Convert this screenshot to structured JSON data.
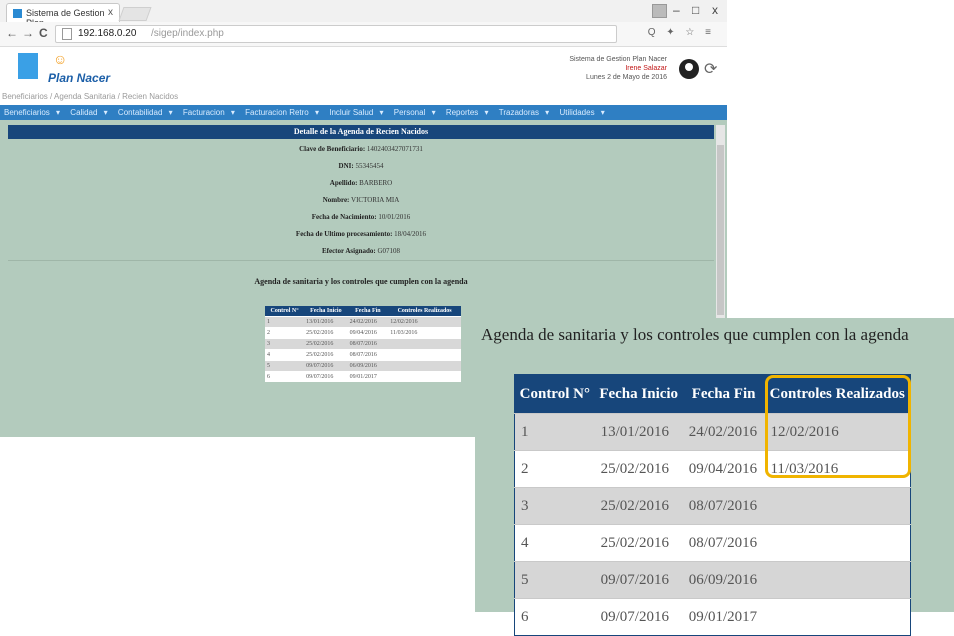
{
  "browser": {
    "tab_title": "Sistema de Gestion Plan",
    "tab_close": "x",
    "window_controls": {
      "minimize": "–",
      "maximize": "□",
      "close": "x"
    },
    "nav": {
      "back": "←",
      "forward": "→",
      "reload": "C"
    },
    "url_host": "192.168.0.20",
    "url_path": "/sigep/index.php",
    "addr_icons": "Q ✦ ☆ ≡"
  },
  "header": {
    "logo_label": "Plan Nacer",
    "system_name": "Sistema de Gestion Plan Nacer",
    "user_name": "Irene Salazar",
    "date": "Lunes 2 de Mayo de 2016",
    "logout_icon": "logout-icon"
  },
  "breadcrumb": "Beneficiarios / Agenda Sanitaria / Recien Nacidos",
  "menu": {
    "items": [
      "Beneficiarios",
      "Calidad",
      "Contabilidad",
      "Facturacion",
      "Facturacion Retro",
      "Incluir Salud",
      "Personal",
      "Reportes",
      "Trazadoras",
      "Utilidades"
    ]
  },
  "detail": {
    "title": "Detalle de la Agenda de Recien Nacidos",
    "fields": [
      {
        "label": "Clave de Beneficiario:",
        "value": "1402403427071731"
      },
      {
        "label": "DNI:",
        "value": "55345454"
      },
      {
        "label": "Apellido:",
        "value": "BARBERO"
      },
      {
        "label": "Nombre:",
        "value": "VICTORIA MIA"
      },
      {
        "label": "Fecha de Nacimiento:",
        "value": "10/01/2016"
      },
      {
        "label": "Fecha de Ultimo procesamiento:",
        "value": "18/04/2016"
      },
      {
        "label": "Efector Asignado:",
        "value": "G07108"
      }
    ]
  },
  "agenda": {
    "title": "Agenda de sanitaria y los controles que cumplen con la agenda",
    "headers": [
      "Control N°",
      "Fecha Inicio",
      "Fecha Fin",
      "Controles Realizados"
    ],
    "rows": [
      [
        "1",
        "13/01/2016",
        "24/02/2016",
        "12/02/2016"
      ],
      [
        "2",
        "25/02/2016",
        "09/04/2016",
        "11/03/2016"
      ],
      [
        "3",
        "25/02/2016",
        "08/07/2016",
        ""
      ],
      [
        "4",
        "25/02/2016",
        "08/07/2016",
        ""
      ],
      [
        "5",
        "09/07/2016",
        "06/09/2016",
        ""
      ],
      [
        "6",
        "09/07/2016",
        "09/01/2017",
        ""
      ]
    ]
  },
  "highlight_color": "#f0b400"
}
